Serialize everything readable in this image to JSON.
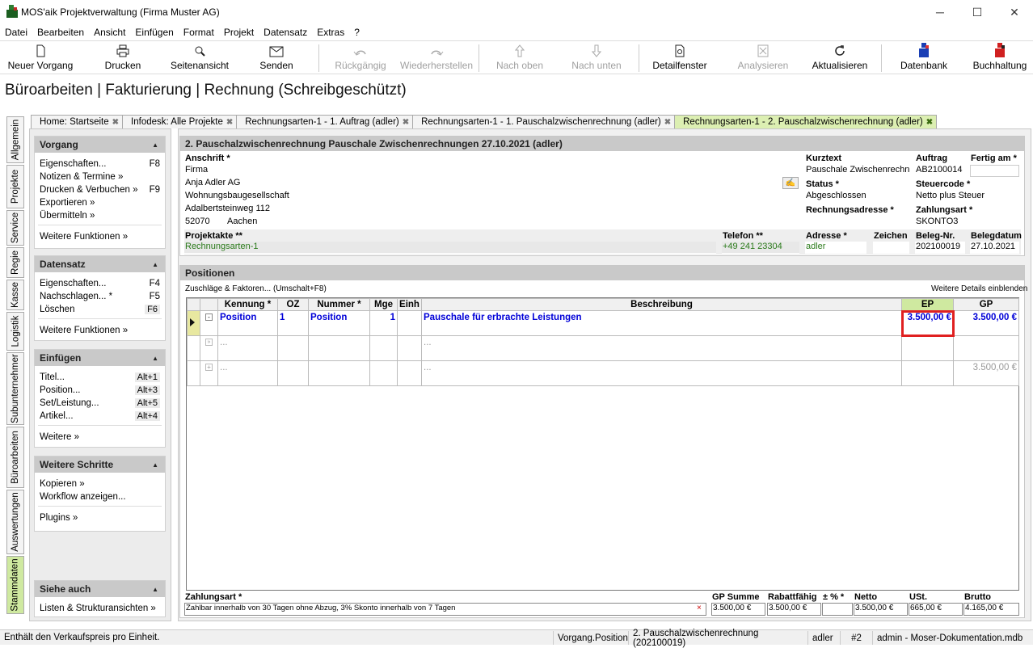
{
  "window": {
    "title": "MOS'aik Projektverwaltung (Firma Muster AG)",
    "minimize": "─",
    "maximize": "☐",
    "close": "✕"
  },
  "menu": [
    "Datei",
    "Bearbeiten",
    "Ansicht",
    "Einfügen",
    "Format",
    "Projekt",
    "Datensatz",
    "Extras",
    "?"
  ],
  "toolbar": {
    "neuer_vorgang": "Neuer Vorgang",
    "drucken": "Drucken",
    "seitenansicht": "Seitenansicht",
    "senden": "Senden",
    "rueckgaengig": "Rückgängig",
    "wiederherstellen": "Wiederherstellen",
    "nach_oben": "Nach oben",
    "nach_unten": "Nach unten",
    "detailfenster": "Detailfenster",
    "analysieren": "Analysieren",
    "aktualisieren": "Aktualisieren",
    "datenbank": "Datenbank",
    "buchhaltung": "Buchhaltung"
  },
  "page_title": "Büroarbeiten | Fakturierung | Rechnung (Schreibgeschützt)",
  "tabs": [
    {
      "label": "Home: Startseite"
    },
    {
      "label": "Infodesk: Alle Projekte"
    },
    {
      "label": "Rechnungsarten-1 - 1. Auftrag (adler)"
    },
    {
      "label": "Rechnungsarten-1 - 1. Pauschalzwischenrechnung (adler)"
    },
    {
      "label": "Rechnungsarten-1 - 2. Pauschalzwischenrechnung (adler)"
    }
  ],
  "tab_close": "✖",
  "vtabs": [
    "Allgemein",
    "Projekte",
    "Service",
    "Regie",
    "Kasse",
    "Logistik",
    "Subunternehmer",
    "Büroarbeiten",
    "Auswertungen",
    "Stammdaten"
  ],
  "left": {
    "vorgang": {
      "title": "Vorgang",
      "items": [
        {
          "label": "Eigenschaften...",
          "key": "F8"
        },
        {
          "label": "Notizen & Termine »",
          "key": ""
        },
        {
          "label": "Drucken & Verbuchen »",
          "key": "F9"
        },
        {
          "label": "Exportieren »",
          "key": ""
        },
        {
          "label": "Übermitteln »",
          "key": ""
        }
      ],
      "more": "Weitere Funktionen »"
    },
    "datensatz": {
      "title": "Datensatz",
      "items": [
        {
          "label": "Eigenschaften...",
          "key": "F4"
        },
        {
          "label": "Nachschlagen... *",
          "key": "F5"
        },
        {
          "label": "Löschen",
          "key": "F6"
        }
      ],
      "more": "Weitere Funktionen »"
    },
    "einfuegen": {
      "title": "Einfügen",
      "items": [
        {
          "label": "Titel...",
          "key": "Alt+1"
        },
        {
          "label": "Position...",
          "key": "Alt+3"
        },
        {
          "label": "Set/Leistung...",
          "key": "Alt+5"
        },
        {
          "label": "Artikel...",
          "key": "Alt+4"
        }
      ],
      "more": "Weitere »"
    },
    "schritte": {
      "title": "Weitere Schritte",
      "items": [
        {
          "label": "Kopieren »"
        },
        {
          "label": "Workflow anzeigen..."
        }
      ],
      "more": "Plugins »"
    },
    "siehe": {
      "title": "Siehe auch",
      "item": "Listen & Strukturansichten »"
    },
    "collapse": "▲"
  },
  "doc": {
    "header": "2. Pauschalzwischenrechnung Pauschale Zwischenrechnungen 27.10.2021 (adler)",
    "anschrift_label": "Anschrift *",
    "address": [
      "Firma",
      "Anja Adler AG",
      "Wohnungsbaugesellschaft",
      "Adalbertsteinweg 112"
    ],
    "plz": "52070",
    "ort": "Aachen",
    "kurztext_label": "Kurztext",
    "kurztext": "Pauschale Zwischenrechnu",
    "auftrag_label": "Auftrag",
    "auftrag": "AB2100014",
    "fertig_label": "Fertig am *",
    "fertig": "",
    "status_label": "Status *",
    "status": "Abgeschlossen",
    "steuer_label": "Steuercode *",
    "steuer": "Netto plus Steuer",
    "radr_label": "Rechnungsadresse *",
    "radr": "",
    "zart_label": "Zahlungsart *",
    "zart": "SKONTO3",
    "projektakte_label": "Projektakte **",
    "projektakte": "Rechnungsarten-1",
    "telefon_label": "Telefon **",
    "telefon": "+49 241 23304",
    "adresse_label": "Adresse *",
    "adresse": "adler",
    "zeichen_label": "Zeichen",
    "zeichen": "",
    "belegnr_label": "Beleg-Nr.",
    "belegnr": "202100019",
    "belegdatum_label": "Belegdatum",
    "belegdatum": "27.10.2021"
  },
  "positions": {
    "title": "Positionen",
    "zuschlaege": "Zuschläge & Faktoren... (Umschalt+F8)",
    "details": "Weitere Details einblenden",
    "cols": {
      "kennung": "Kennung *",
      "oz": "OZ",
      "nummer": "Nummer *",
      "mge": "Mge",
      "einh": "Einh",
      "beschreibung": "Beschreibung",
      "ep": "EP",
      "gp": "GP"
    },
    "row": {
      "kennung": "Position",
      "oz": "1",
      "nummer": "Position",
      "mge": "1",
      "einh": "",
      "beschreibung": "Pauschale für erbrachte Leistungen",
      "ep": "3.500,00 €",
      "gp": "3.500,00 €"
    },
    "ellipsis": "...",
    "total": "3.500,00 €"
  },
  "footer": {
    "zahlungsart_label": "Zahlungsart *",
    "zahlungsart": "Zahlbar innerhalb von 30 Tagen ohne Abzug, 3% Skonto innerhalb von 7 Tagen",
    "gpsumme_label": "GP Summe",
    "gpsumme": "3.500,00 €",
    "rabatt_label": "Rabattfähig",
    "rabatt": "3.500,00 €",
    "pm_label": "± % *",
    "pm": "",
    "netto_label": "Netto",
    "netto": "3.500,00 €",
    "ust_label": "USt.",
    "ust": "665,00 €",
    "brutto_label": "Brutto",
    "brutto": "4.165,00 €",
    "clear": "×"
  },
  "status": {
    "hint": "Enthält den Verkaufspreis pro Einheit.",
    "context": "Vorgang.Position",
    "doc": "2. Pauschalzwischenrechnung (202100019)",
    "user": "adler",
    "num": "#2",
    "db": "admin - Moser-Dokumentation.mdb"
  },
  "colors": {
    "active_tab": "#dcefb2",
    "highlight": "#e02020",
    "blue_text": "#0000d8",
    "green_text": "#2a7a1a"
  }
}
